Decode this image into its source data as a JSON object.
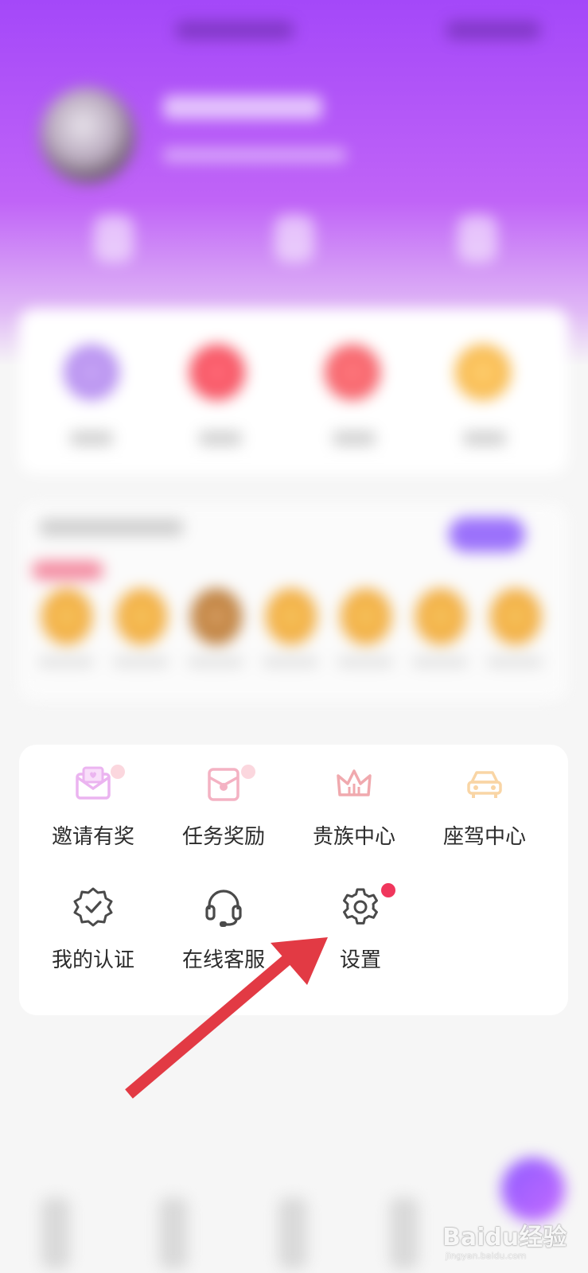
{
  "menu": {
    "items": [
      {
        "label": "邀请有奖",
        "icon": "invite-envelope-icon",
        "badge": true
      },
      {
        "label": "任务奖励",
        "icon": "task-reward-icon",
        "badge": true
      },
      {
        "label": "贵族中心",
        "icon": "crown-icon",
        "badge": false
      },
      {
        "label": "座驾中心",
        "icon": "car-icon",
        "badge": false
      },
      {
        "label": "我的认证",
        "icon": "verified-badge-icon",
        "badge": false
      },
      {
        "label": "在线客服",
        "icon": "headset-icon",
        "badge": false
      },
      {
        "label": "设置",
        "icon": "gear-icon",
        "badge": true
      }
    ]
  },
  "annotation": {
    "arrow_color": "#e23a44",
    "points_to": "设置"
  },
  "watermark": {
    "brand": "Baidu经验",
    "url": "jingyan.baidu.com"
  },
  "colors": {
    "header_purple": "#a448f9",
    "badge_red": "#f0365c",
    "icon_grey": "#4a4a4a"
  }
}
